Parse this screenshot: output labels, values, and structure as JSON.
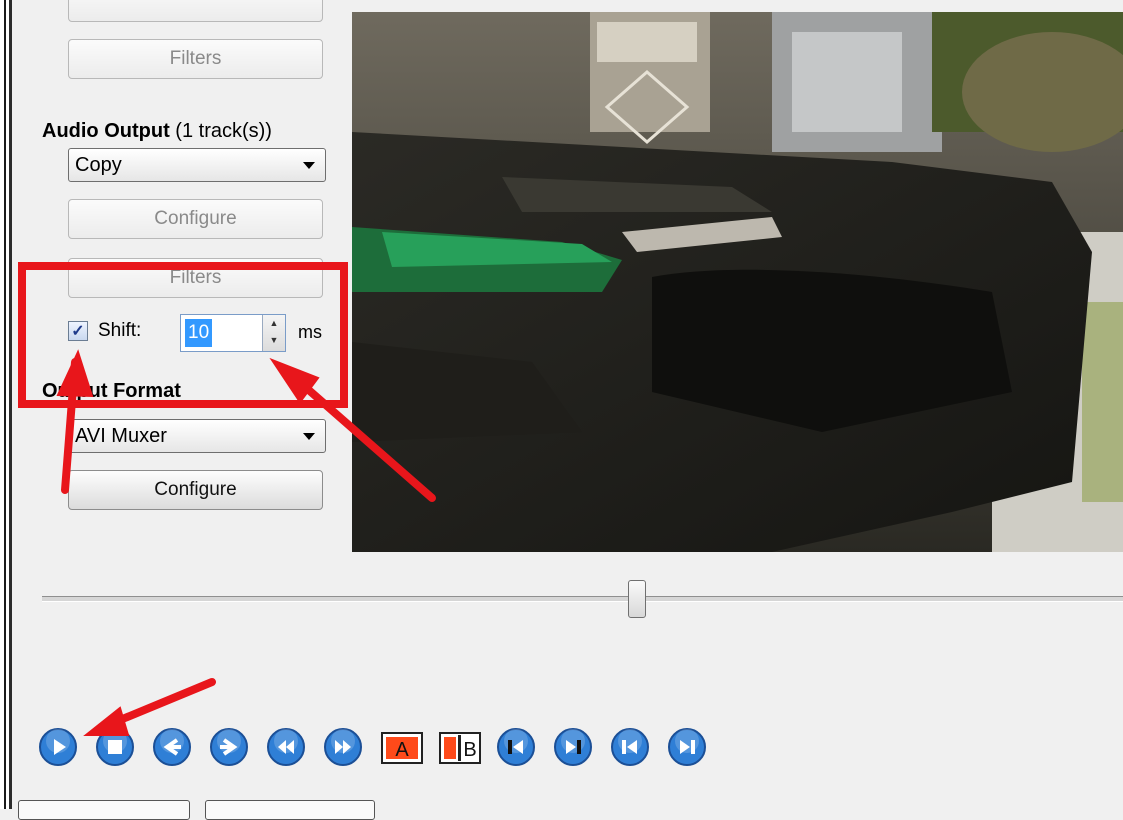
{
  "video_filters_label": "Filters",
  "audio_output": {
    "heading_bold": "Audio Output",
    "heading_suffix": " (1 track(s))",
    "codec": "Copy",
    "configure_label": "Configure",
    "filters_label": "Filters",
    "shift_label": "Shift:",
    "shift_checked": true,
    "shift_value": "10",
    "shift_unit": "ms"
  },
  "output_format": {
    "heading": "Output Format",
    "muxer": "AVI Muxer",
    "configure_label": "Configure"
  },
  "timeline": {
    "position_fraction": 0.55
  },
  "toolbar": [
    {
      "name": "play-icon"
    },
    {
      "name": "stop-icon"
    },
    {
      "name": "previous-frame-icon"
    },
    {
      "name": "next-frame-icon"
    },
    {
      "name": "rewind-icon"
    },
    {
      "name": "fast-forward-icon"
    },
    {
      "name": "set-marker-a-icon",
      "label": "A"
    },
    {
      "name": "set-marker-b-icon",
      "label": "B"
    },
    {
      "name": "previous-keyframe-icon"
    },
    {
      "name": "next-keyframe-icon"
    },
    {
      "name": "go-to-first-frame-icon"
    },
    {
      "name": "go-to-last-frame-icon"
    }
  ],
  "colors": {
    "annotation_red": "#e8161b",
    "toolbar_blue": "#2f7fd6",
    "marker_orange": "#ff4a1a"
  }
}
